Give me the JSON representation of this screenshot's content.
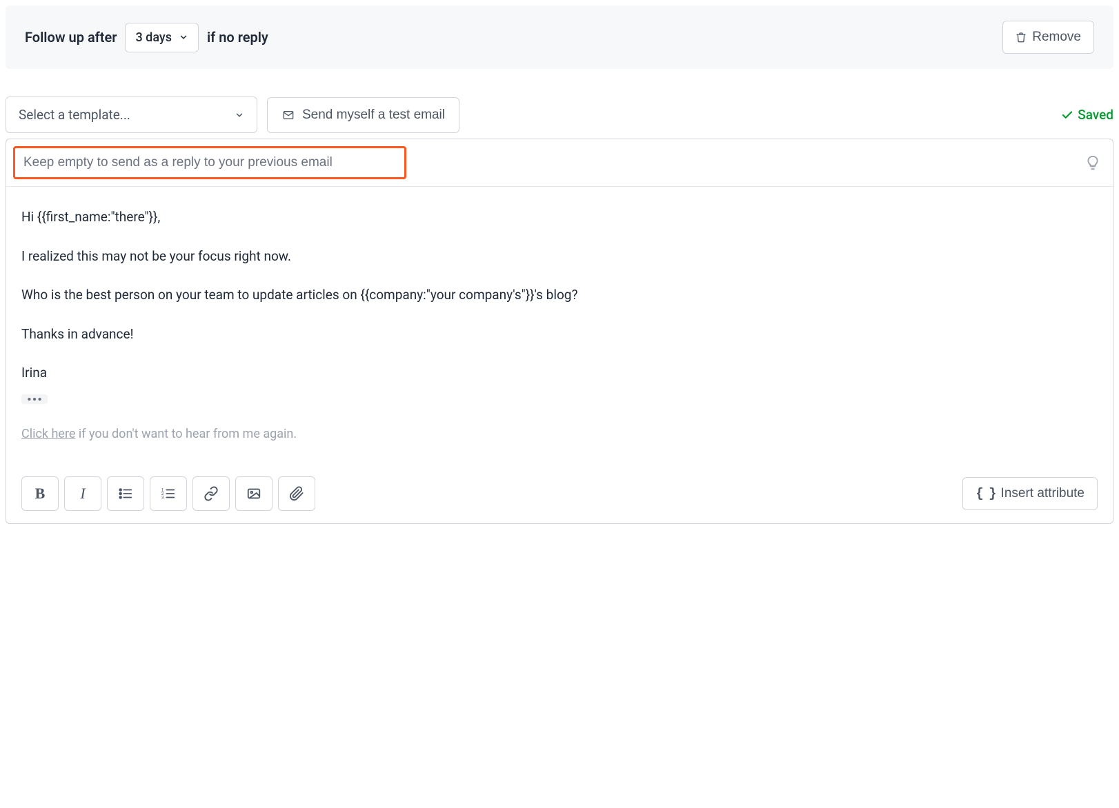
{
  "followup": {
    "prefix": "Follow up after",
    "days_value": "3 days",
    "suffix": "if no reply",
    "remove_label": "Remove"
  },
  "template_row": {
    "select_placeholder": "Select a template...",
    "test_email_label": "Send myself a test email",
    "saved_label": "Saved"
  },
  "subject": {
    "placeholder": "Keep empty to send as a reply to your previous email",
    "value": ""
  },
  "body": {
    "line1": "Hi {{first_name:\"there\"}},",
    "line2": "I realized this may not be your focus right now.",
    "line3": "Who is the best person on your team to update articles on {{company:\"your company's\"}}'s blog?",
    "line4": "Thanks in advance!",
    "signature": "Irina"
  },
  "unsubscribe": {
    "link_text": "Click here",
    "rest": " if you don't want to hear from me again."
  },
  "toolbar": {
    "bold": "B",
    "italic": "I",
    "insert_attribute_label": "Insert attribute"
  }
}
